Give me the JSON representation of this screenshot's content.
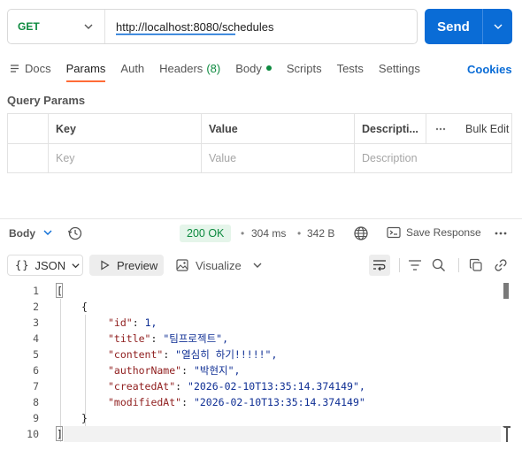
{
  "request": {
    "method": "GET",
    "url": "http://localhost:8080/schedules",
    "send_label": "Send"
  },
  "tabs": [
    {
      "label": "Docs",
      "icon": "doc-icon"
    },
    {
      "label": "Params",
      "active": true
    },
    {
      "label": "Auth"
    },
    {
      "label": "Headers",
      "count": "(8)"
    },
    {
      "label": "Body",
      "indicator": "green-dot"
    },
    {
      "label": "Scripts"
    },
    {
      "label": "Tests"
    },
    {
      "label": "Settings"
    }
  ],
  "cookies_label": "Cookies",
  "query_params": {
    "title": "Query Params",
    "headers": [
      "Key",
      "Value",
      "Descripti..."
    ],
    "bulk_edit": "Bulk Edit",
    "placeholders": [
      "Key",
      "Value",
      "Description"
    ]
  },
  "response": {
    "body_label": "Body",
    "status": "200 OK",
    "time": "304 ms",
    "size": "342 B",
    "save_label": "Save Response",
    "separator": "•"
  },
  "toolbar": {
    "format": "JSON",
    "format_prefix": "{}",
    "preview": "Preview",
    "visualize": "Visualize"
  },
  "code_lines": [
    {
      "num": "1",
      "text": "["
    },
    {
      "num": "2",
      "text": "{"
    },
    {
      "num": "3",
      "key": "\"id\"",
      "value": "1,"
    },
    {
      "num": "4",
      "key": "\"title\"",
      "value": "\"팀프로젝트\","
    },
    {
      "num": "5",
      "key": "\"content\"",
      "value": "\"열심히 하기!!!!!\","
    },
    {
      "num": "6",
      "key": "\"authorName\"",
      "value": "\"박현지\","
    },
    {
      "num": "7",
      "key": "\"createdAt\"",
      "value": "\"2026-02-10T13:35:14.374149\","
    },
    {
      "num": "8",
      "key": "\"modifiedAt\"",
      "value": "\"2026-02-10T13:35:14.374149\""
    },
    {
      "num": "9",
      "text": "}"
    },
    {
      "num": "10",
      "text": "]"
    }
  ],
  "colors": {
    "accent": "#ff6c37",
    "send": "#0a6cd6",
    "method": "#0d8a3f",
    "status_bg": "#e5f5ea"
  }
}
